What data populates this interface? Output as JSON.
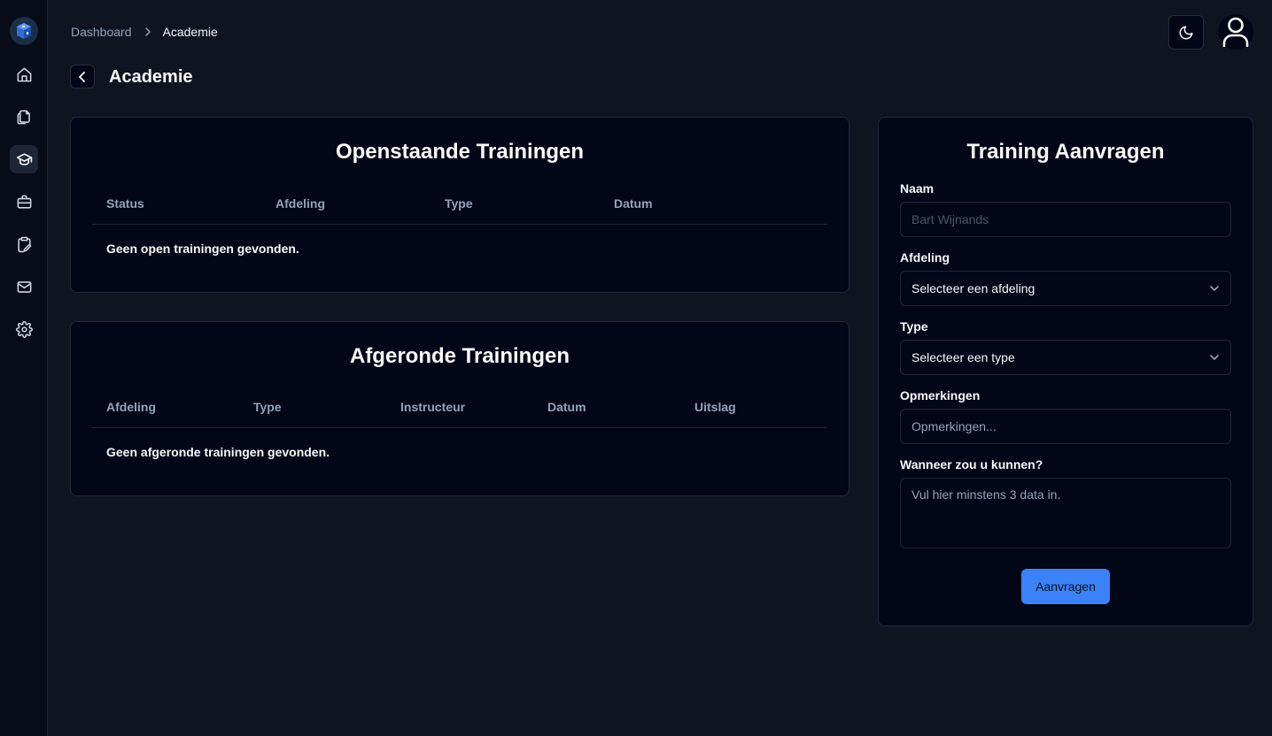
{
  "breadcrumb": {
    "home": "Dashboard",
    "current": "Academie"
  },
  "page": {
    "title": "Academie"
  },
  "open_trainings": {
    "title": "Openstaande Trainingen",
    "columns": [
      "Status",
      "Afdeling",
      "Type",
      "Datum"
    ],
    "empty": "Geen open trainingen gevonden."
  },
  "completed_trainings": {
    "title": "Afgeronde Trainingen",
    "columns": [
      "Afdeling",
      "Type",
      "Instructeur",
      "Datum",
      "Uitslag"
    ],
    "empty": "Geen afgeronde trainingen gevonden."
  },
  "request_form": {
    "title": "Training Aanvragen",
    "name_label": "Naam",
    "name_placeholder": "Bart Wijnands",
    "department_label": "Afdeling",
    "department_value": "Selecteer een afdeling",
    "type_label": "Type",
    "type_value": "Selecteer een type",
    "remarks_label": "Opmerkingen",
    "remarks_placeholder": "Opmerkingen...",
    "availability_label": "Wanneer zou u kunnen?",
    "availability_placeholder": "Vul hier minstens 3 data in.",
    "submit_label": "Aanvragen"
  },
  "sidebar": {
    "items": [
      "home-icon",
      "documents-icon",
      "academy-icon",
      "briefcase-icon",
      "clipboard-icon",
      "mail-icon",
      "settings-icon"
    ],
    "active": "academy-icon"
  },
  "colors": {
    "accent": "#3b82f6",
    "background": "#0f1420",
    "card": "#020617"
  }
}
